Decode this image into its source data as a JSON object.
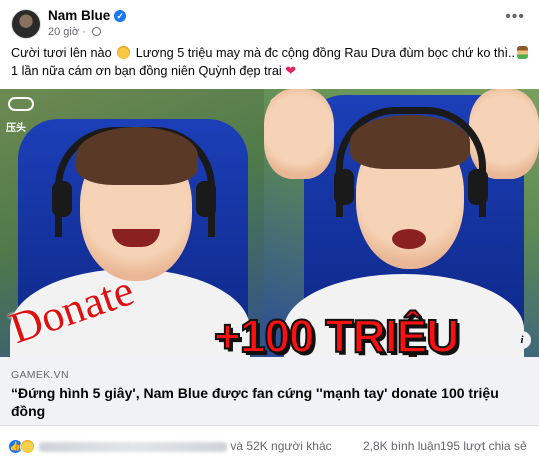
{
  "post": {
    "author": "Nam Blue",
    "time": "20 giờ",
    "caption_part1": "Cười tươi lên nào",
    "caption_part2": "Lương 5 triệu may mà đc cộng đồng Rau Dưa đùm bọc chứ ko thì..",
    "caption_part3": "1 lần nữa cám ơn bạn đồng niên Quỳnh đẹp trai",
    "heart": "❤"
  },
  "media": {
    "overlay_left": "Donate",
    "overlay_right": "+100 TRIỆU",
    "game_icon_label": "压头",
    "info_icon": "i"
  },
  "link_preview": {
    "domain": "GAMEK.VN",
    "headline": "“Đứng hình 5 giây', Nam Blue được fan cứng ''mạnh tay' donate 100 triệu đồng"
  },
  "footer": {
    "reactions_text": "và 52K người khác",
    "comments": "2,8K bình luận",
    "shares": "195 lượt chia sẻ"
  },
  "colors": {
    "brand": "#1877f2",
    "overlay_red": "#e01010",
    "secondary_text": "#65676b"
  },
  "icons": [
    "verified-badge-icon",
    "globe-icon",
    "more-options-icon",
    "sweat-smile-emoji",
    "person-emoji",
    "heart-emoji",
    "info-icon",
    "like-reaction-icon",
    "haha-reaction-icon"
  ]
}
